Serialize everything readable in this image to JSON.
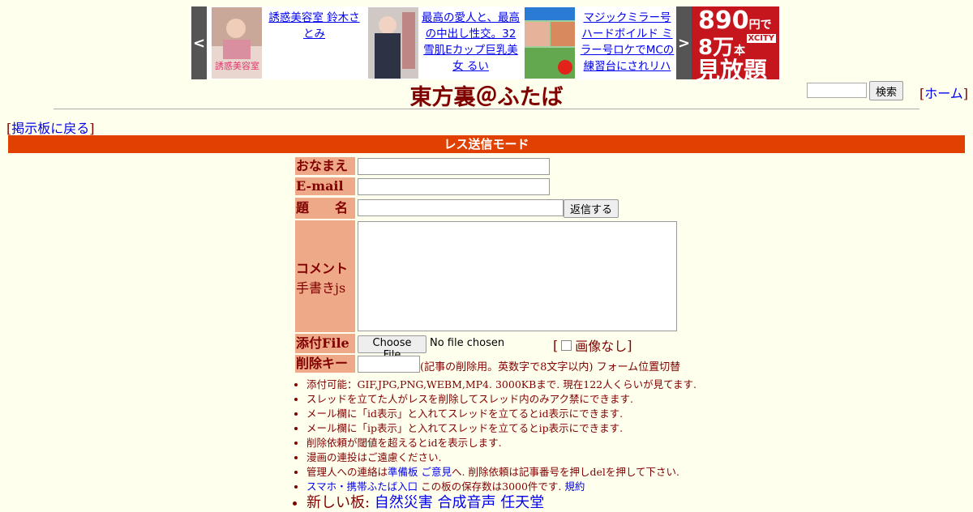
{
  "ads": {
    "prev_arrow": "<",
    "next_arrow": ">",
    "items": [
      {
        "text": "誘惑美容室 鈴木さとみ"
      },
      {
        "text": "最高の愛人と、最高の中出し性交。32 雪肌Eカップ巨乳美女 るい"
      },
      {
        "text": "マジックミラー号 ハードボイルド ミラー号ロケでMCの練習台にされリハ"
      }
    ],
    "banner": {
      "line1": "890",
      "line1_unit": "円で",
      "line2": "8万",
      "line2_unit": "本",
      "line3": "見放題",
      "brand": "XCITY"
    }
  },
  "header": {
    "title": "東方裏＠ふたば",
    "search_button": "検索",
    "home_open": "[",
    "home_link": "ホーム",
    "home_close": "]"
  },
  "nav": {
    "back_open": "[",
    "back_link": "掲示板に戻る",
    "back_close": "]"
  },
  "mode_bar": "レス送信モード",
  "form": {
    "name_label": "おなまえ",
    "email_label": "E-mail",
    "subject_label": "題　　名",
    "submit_button": "返信する",
    "comment_label": "コメント",
    "handwriting_link": "手書きjs",
    "file_label": "添付File",
    "choose_file_button": "Choose File",
    "no_file_text": "No file chosen",
    "no_image_open": "[",
    "no_image_label": "画像なし",
    "no_image_close": "]",
    "delete_key_label": "削除キー",
    "delete_key_note": "(記事の削除用。英数字で8文字以内)",
    "form_position_link": "フォーム位置切替"
  },
  "notes": {
    "n1": "添付可能：GIF,JPG,PNG,WEBM,MP4. 3000KBまで. 現在122人くらいが見てます.",
    "n2": "スレッドを立てた人がレスを削除してスレッド内のみアク禁にできます.",
    "n3": "メール欄に「id表示」と入れてスレッドを立てるとid表示にできます.",
    "n4": "メール欄に「ip表示」と入れてスレッドを立てるとip表示にできます.",
    "n5": "削除依頼が閾値を超えるとidを表示します.",
    "n6": "漫画の連投はご遠慮ください.",
    "n7_pre": "管理人への連絡は",
    "n7_link1": "準備板",
    "n7_link2": "ご意見",
    "n7_mid": "へ. 削除依頼は記事番号を押し",
    "n7_link3": "del",
    "n7_post": "を押して下さい.",
    "n8_link": "スマホ・携帯ふたば入口",
    "n8_text": " この板の保存数は3000件です.",
    "n8_link2": "規約",
    "n9_label": "新しい板: ",
    "n9_links": [
      "自然災害",
      "合成音声",
      "任天堂"
    ]
  }
}
